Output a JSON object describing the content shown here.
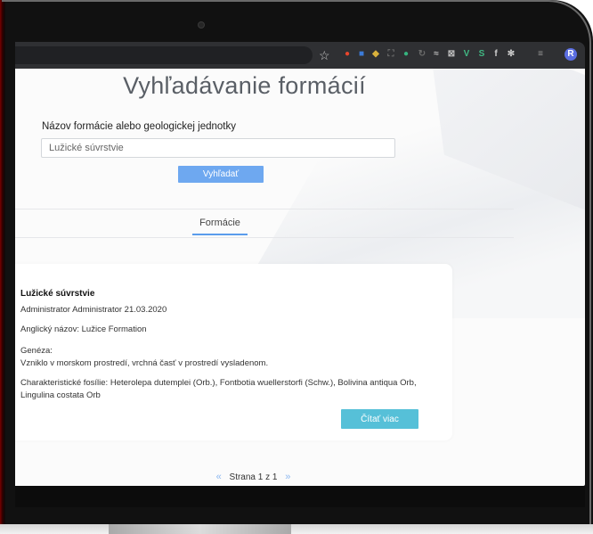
{
  "browser": {
    "extensions": [
      {
        "icon": "opera-icon",
        "color": "#e8452c",
        "glyph": "●"
      },
      {
        "icon": "translate-icon",
        "color": "#3c7bd9",
        "glyph": "■"
      },
      {
        "icon": "color-picker-icon",
        "color": "#d9b13c",
        "glyph": "◆"
      },
      {
        "icon": "screenshot-icon",
        "color": "#6a6a6a",
        "glyph": "⛶"
      },
      {
        "icon": "green-dot-icon",
        "color": "#36b37e",
        "glyph": "●"
      },
      {
        "icon": "refresh-icon",
        "color": "#6a6a6a",
        "glyph": "↻"
      },
      {
        "icon": "php-icon",
        "color": "#bdbdbd",
        "glyph": "≈"
      },
      {
        "icon": "box-icon",
        "color": "#bdbdbd",
        "glyph": "⊠"
      },
      {
        "icon": "vue-icon",
        "color": "#41b883",
        "glyph": "V"
      },
      {
        "icon": "s-icon",
        "color": "#41b883",
        "glyph": "S"
      },
      {
        "icon": "facebook-icon",
        "color": "#cfcfcf",
        "glyph": "f"
      },
      {
        "icon": "react-icon",
        "color": "#cfcfcf",
        "glyph": "✻"
      },
      {
        "icon": "queue-icon",
        "color": "#9a9a9a",
        "glyph": "≡"
      },
      {
        "icon": "profile-avatar-icon",
        "color": "#5b6ee1",
        "glyph": "R"
      }
    ]
  },
  "page": {
    "title": "Vyhľadávanie formácií",
    "field_label": "Názov formácie alebo geologickej jednotky",
    "search_value": "Lužické súvrstvie",
    "search_button": "Vyhľadať",
    "tab": "Formácie"
  },
  "result": {
    "name": "Lužické súvrstvie",
    "author_date": "Administrator Administrator 21.03.2020",
    "english_name": "Anglický názov: Lužice Formation",
    "genesis_label": "Genéza:",
    "genesis_text": "Vzniklo v morskom prostredí, vrchná časť v prostredí vysladenom.",
    "fossils_line1": "Charakteristické fosílie: Heterolepa dutemplei (Orb.), Fontbotia wuellerstorfi (Schw.), Bolivina antiqua Orb,",
    "fossils_line2": "Lingulina costata Orb",
    "read_more": "Čítať viac"
  },
  "pager": {
    "prev": "«",
    "label": "Strana 1 z 1",
    "next": "»"
  },
  "colors": {
    "primary_button": "#6ea8f0",
    "read_more_button": "#56c0d8",
    "tab_underline": "#5a9cec"
  }
}
